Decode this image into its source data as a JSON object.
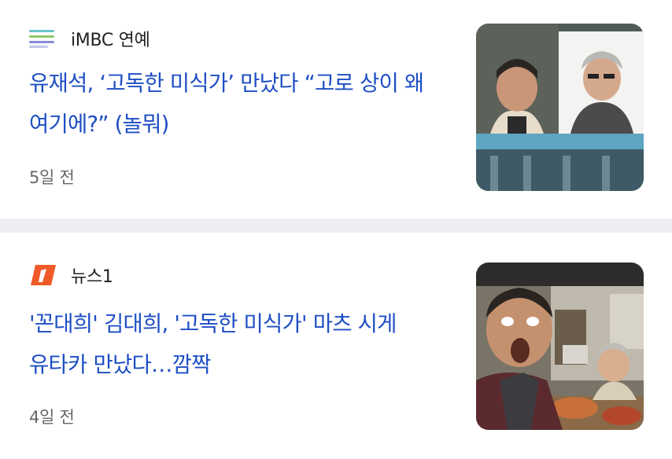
{
  "articles": [
    {
      "source": "iMBC 연예",
      "source_logo": "imbc-lines-logo",
      "headline": "유재석, ‘고독한 미식가’ 만났다 “고로 상이 왜 여기에?” (놀뭐)",
      "time": "5일 전"
    },
    {
      "source": "뉴스1",
      "source_logo": "news1-logo",
      "headline": "'꼰대희' 김대희, '고독한 미식가' 마츠 시게 유타카 만났다…깜짝",
      "time": "4일 전"
    }
  ],
  "colors": {
    "headline": "#1d4ec4",
    "divider": "#eceef1",
    "news1_orange": "#f05a28"
  }
}
